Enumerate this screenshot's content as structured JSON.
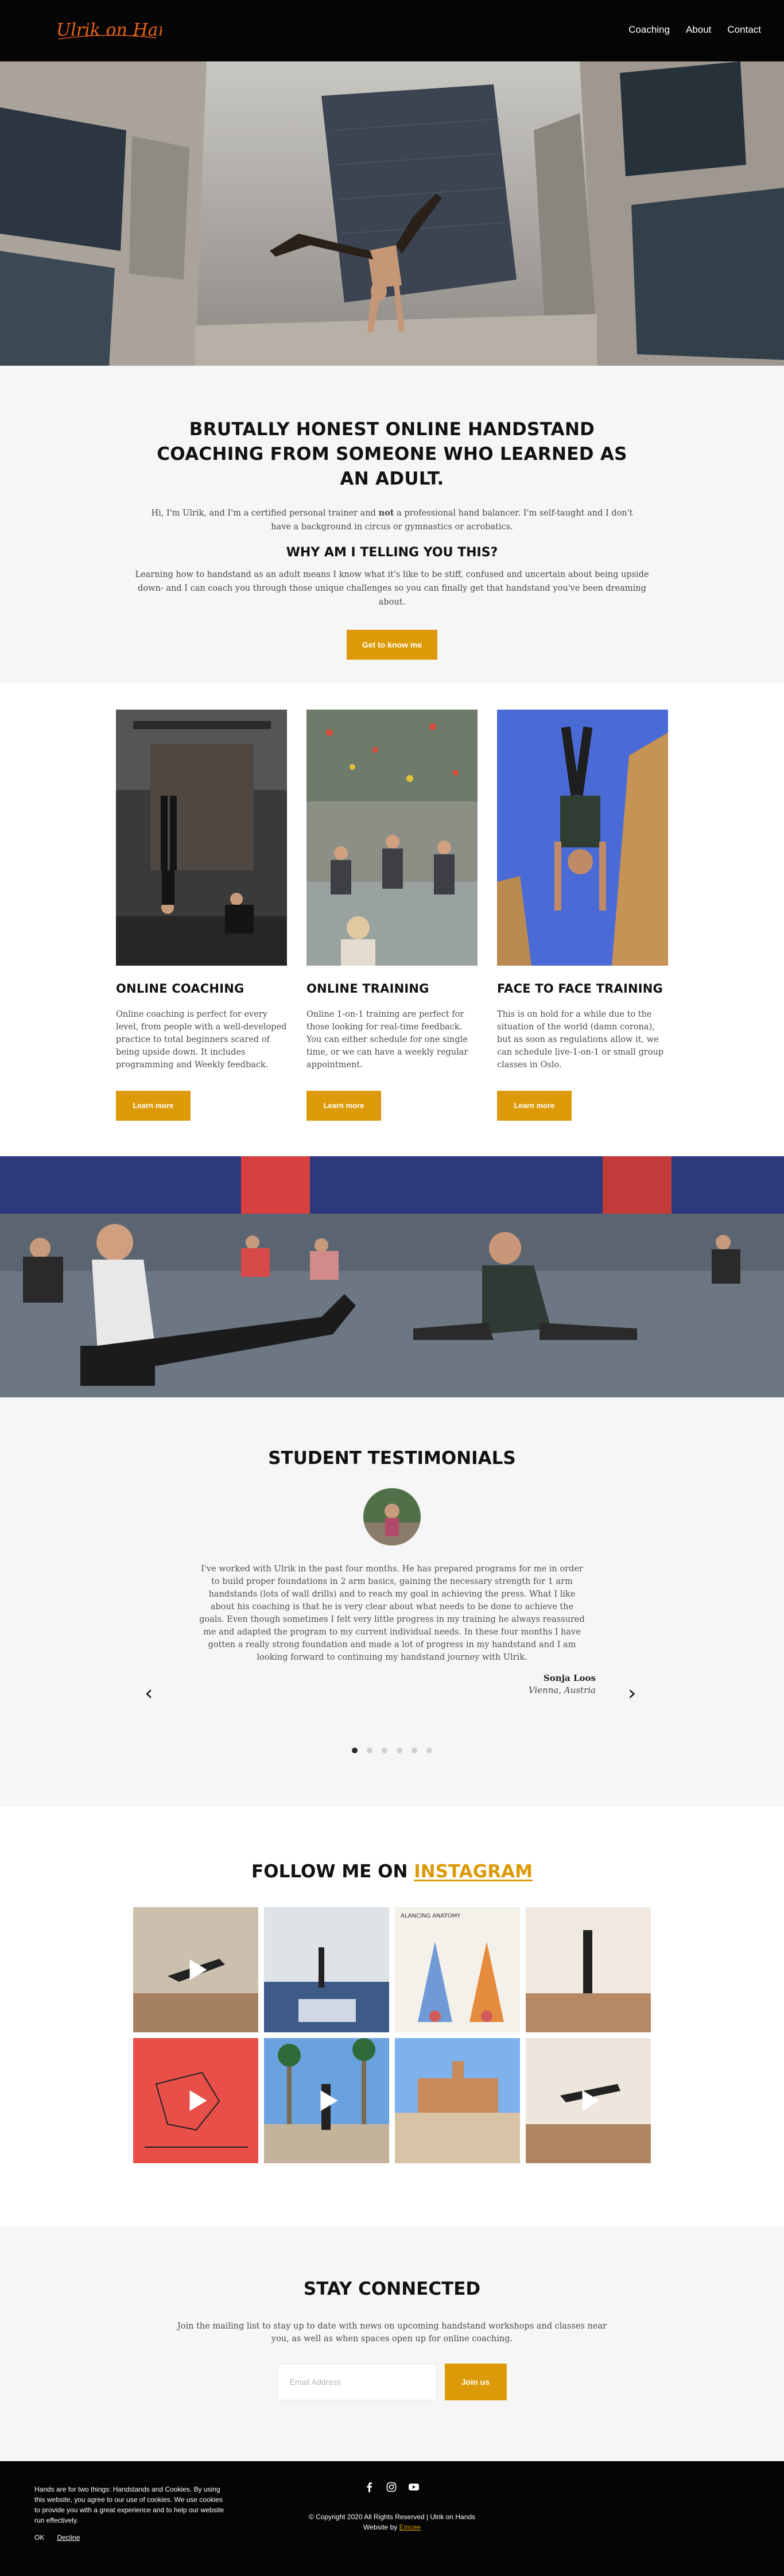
{
  "header": {
    "logo_text": "Ulrik on Hands",
    "nav": [
      "Coaching",
      "About",
      "Contact"
    ]
  },
  "intro": {
    "title": "BRUTALLY HONEST ONLINE HANDSTAND COACHING FROM SOMEONE WHO LEARNED AS AN ADULT.",
    "p1_before": "Hi, I'm Ulrik, and I'm a certified personal trainer and ",
    "p1_bold": "not",
    "p1_after": " a professional hand balancer. I'm self-taught and I don't have a background in circus or gymnastics or acrobatics.",
    "subtitle": "WHY AM I TELLING YOU THIS?",
    "p2": "Learning how to handstand as an adult means I know what it's like to be stiff, confused and uncertain about being upside down- and I can coach you through those unique challenges so you can finally get that handstand you've been dreaming about.",
    "cta": "Get to know me"
  },
  "services": [
    {
      "title": "ONLINE COACHING",
      "text": "Online coaching is perfect for every level, from people with a well-developed practice to total beginners scared of being upside down. It includes programming and Weekly feedback.",
      "button": "Learn more"
    },
    {
      "title": "ONLINE TRAINING",
      "text": "Online 1-on-1 training are perfect for those looking for real-time feedback. You can either schedule for one single time, or we can have a weekly regular appointment.",
      "button": "Learn more"
    },
    {
      "title": "FACE TO FACE TRAINING",
      "text": "This is on hold for a while due to the situation of the world (damn corona), but as soon as regulations allow it, we can schedule live-1-on-1 or small group classes in Oslo.",
      "button": "Learn more"
    }
  ],
  "testimonials": {
    "title": "STUDENT TESTIMONIALS",
    "quote": "I've worked with Ulrik in the past four months. He has prepared programs for me in order to build proper foundations in 2 arm basics, gaining the necessary strength for 1 arm handstands (lots of wall drills) and to reach my goal in achieving the press. What I like about his coaching is that he is very clear about what needs to be done to achieve the goals. Even though sometimes I felt very little progress in my training he always reassured me and adapted the program to my current individual needs. In these four months I have gotten a really strong foundation and made a lot of progress in my handstand and I am looking forward to continuing my handstand journey with Ulrik.",
    "name": "Sonja Loos",
    "location": "Vienna, Austria",
    "prev_icon": "chevron-left",
    "next_icon": "chevron-right",
    "slides": 6,
    "active_slide": 1
  },
  "instagram": {
    "title_prefix": "FOLLOW ME ON ",
    "title_accent": "INSTAGRAM",
    "accent_color": "#dd9a08",
    "balancing_anatomy_text": "ALANCING ANATOMY"
  },
  "newsletter": {
    "title": "STAY CONNECTED",
    "text": "Join the mailing list to stay up to date with news on upcoming handstand workshops and classes near you, as well as when spaces open up for online coaching.",
    "email_placeholder": "Email Address",
    "button": "Join us"
  },
  "footer": {
    "cookie_text": "Hands are for two things: Handstands and Cookies. By using this website, you agree to our use of cookies. We use cookies to provide you with a great experience and to help our website run effectively.",
    "cookie_ok": "OK",
    "cookie_decline": "Decline",
    "social_icons": [
      "facebook-icon",
      "instagram-icon",
      "youtube-icon"
    ],
    "copyright": "© Copyright 2020 All Rights Reserved | Ulrik on Hands",
    "website_by": "Website by ",
    "credit": "Emcee"
  },
  "colors": {
    "accent": "#dd9a08",
    "header_bg": "#050505",
    "section_gray": "#f6f6f6"
  }
}
